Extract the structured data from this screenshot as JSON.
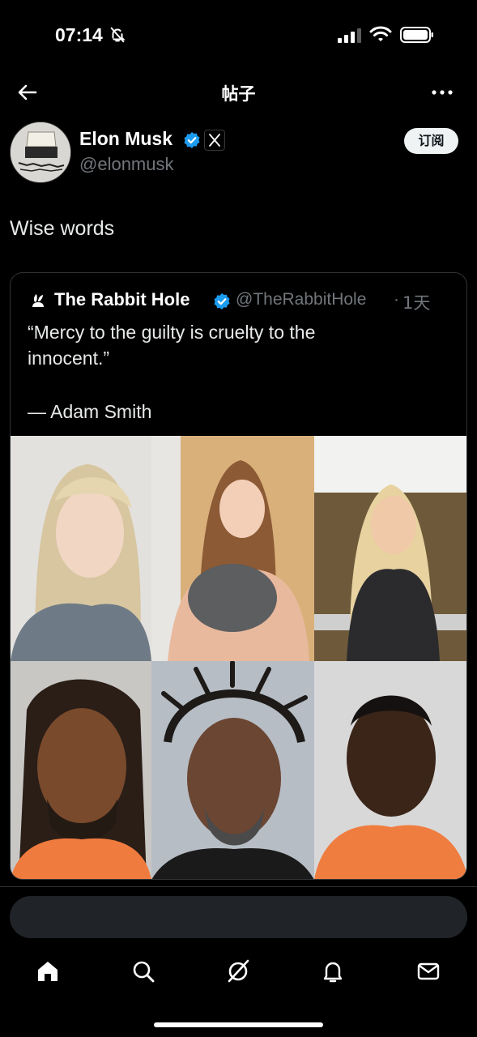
{
  "status_bar": {
    "time": "07:14",
    "icons": [
      "bell-off-icon",
      "signal-icon",
      "wifi-icon",
      "battery-icon"
    ]
  },
  "nav": {
    "title": "帖子",
    "back_icon": "arrow-left-icon",
    "more_icon": "more-horizontal-icon"
  },
  "post": {
    "author_name": "Elon Musk",
    "author_handle": "@elonmusk",
    "subscribe_label": "订阅",
    "text": "Wise words",
    "accent_verified": "#1d9bf0"
  },
  "quote": {
    "name": "The Rabbit Hole",
    "handle": "@TheRabbitHole",
    "separator": "·",
    "time": "1天",
    "line1": "“Mercy to the guilty is cruelty to the",
    "line2": "innocent.”",
    "line3": "— Adam Smith",
    "media": [
      "photo-blonde-woman",
      "photo-woman-holding-cat",
      "photo-blonde-woman-outdoors",
      "mugshot-man-dreadlocks",
      "mugshot-man-twisted-hair",
      "mugshot-man-orange-shirt"
    ]
  },
  "tabbar": {
    "tabs": [
      "home-icon",
      "search-icon",
      "grok-icon",
      "notifications-icon",
      "messages-icon"
    ]
  }
}
